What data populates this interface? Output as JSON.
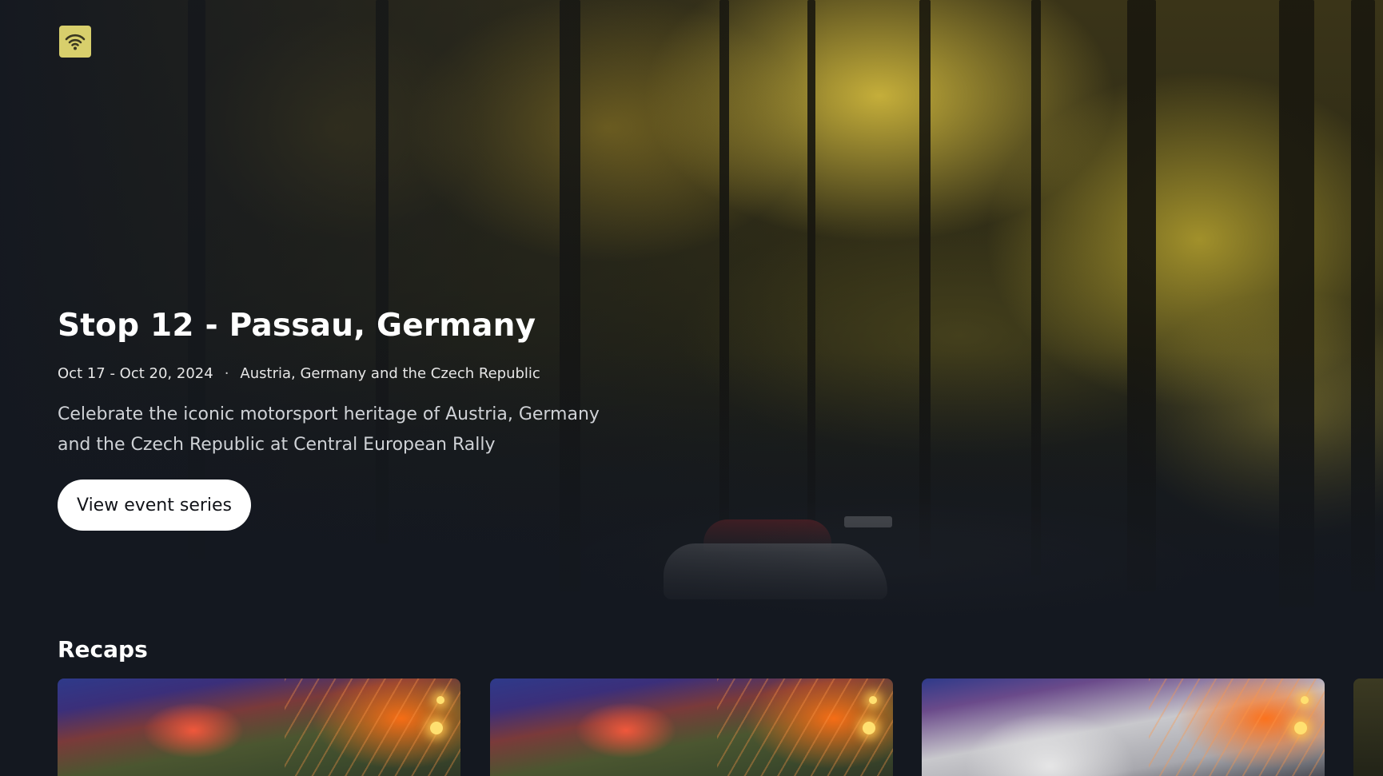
{
  "brand": {
    "logo_icon": "wifi-signal-icon",
    "logo_color": "#d8cf6c"
  },
  "hero": {
    "title": "Stop 12 - Passau, Germany",
    "dates": "Oct 17 - Oct 20, 2024",
    "separator": "·",
    "location": "Austria, Germany and the Czech Republic",
    "description": "Celebrate the iconic motorsport heritage of Austria, Germany and the Czech Republic at Central European Rally",
    "cta_label": "View event series"
  },
  "recaps": {
    "title": "Recaps",
    "items": [
      {
        "thumbnail": "rally-recap-thumbnail"
      },
      {
        "thumbnail": "rally-recap-thumbnail"
      },
      {
        "thumbnail": "rally-recap-thumbnail"
      },
      {
        "thumbnail": "forest-recap-thumbnail"
      }
    ]
  },
  "colors": {
    "background": "#141820",
    "text_primary": "#ffffff",
    "text_secondary": "#cfd2d6",
    "button_bg": "#ffffff",
    "button_text": "#111318"
  }
}
